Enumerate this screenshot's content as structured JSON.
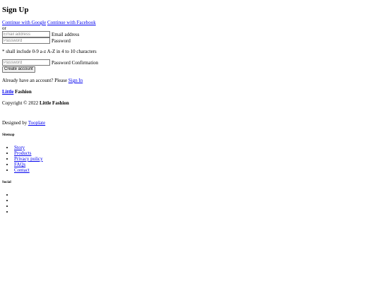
{
  "signup": {
    "title": "Sign Up",
    "google_link": "Continue with Google",
    "facebook_link": "Continue with Facebook",
    "or_text": "or",
    "email": {
      "placeholder": "Email address",
      "label": "Email address"
    },
    "password": {
      "placeholder": "Password",
      "label": "Password"
    },
    "hint": "* shall include 0-9 a-z A-Z in 4 to 10 characters",
    "confirm": {
      "placeholder": "Password",
      "label": "Password Confirmation"
    },
    "create_button": "Create account",
    "already_text": "Already have an account? Please",
    "signin_link": "Sign In"
  },
  "footer": {
    "brand_first": "Little",
    "brand_second": "Fashion",
    "copyright_prefix": "Copyright © 2022",
    "copyright_brand": "Little Fashion",
    "designed_prefix": "Designed by",
    "designed_link": "Tooplate",
    "sitemap_heading": "Sitemap",
    "sitemap_items": [
      "Story",
      "Products",
      "Privacy policy",
      "FAQs",
      "Contact"
    ],
    "social_heading": "Social"
  }
}
